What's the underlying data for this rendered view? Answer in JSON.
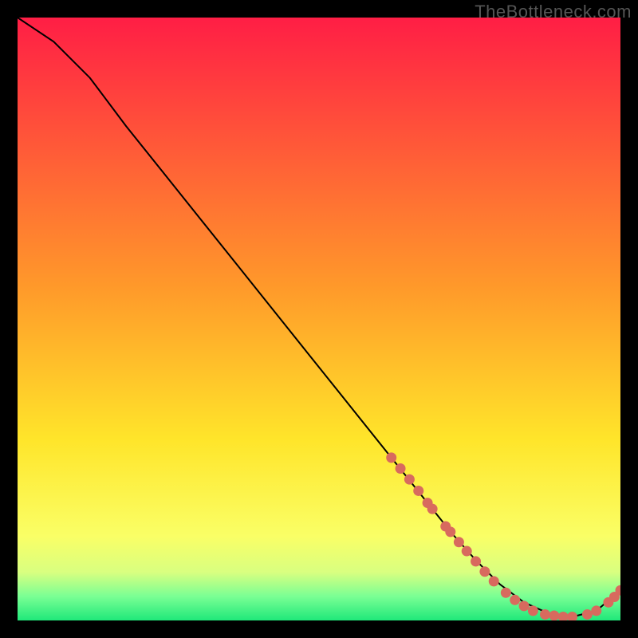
{
  "watermark": "TheBottleneck.com",
  "chart_data": {
    "type": "line",
    "title": "",
    "xlabel": "",
    "ylabel": "",
    "xlim": [
      0,
      100
    ],
    "ylim": [
      0,
      100
    ],
    "gradient_stops": [
      {
        "offset": 0,
        "color": "#ff1e45"
      },
      {
        "offset": 45,
        "color": "#ff9a2a"
      },
      {
        "offset": 70,
        "color": "#ffe52a"
      },
      {
        "offset": 86,
        "color": "#faff66"
      },
      {
        "offset": 92,
        "color": "#d9ff80"
      },
      {
        "offset": 96,
        "color": "#7aff94"
      },
      {
        "offset": 100,
        "color": "#1fe87a"
      }
    ],
    "series": [
      {
        "name": "bottleneck-curve",
        "x": [
          0,
          6,
          12,
          18,
          24,
          30,
          36,
          42,
          48,
          54,
          60,
          64,
          68,
          72,
          76,
          80,
          84,
          88,
          92,
          96,
          100
        ],
        "y": [
          100,
          96,
          90,
          82,
          74.5,
          67,
          59.5,
          52,
          44.5,
          37,
          29.5,
          24.5,
          19.5,
          14.5,
          10,
          6,
          3,
          1.2,
          0.6,
          1.6,
          5
        ]
      }
    ],
    "highlight_points": {
      "name": "marker-dots",
      "color": "#d86a5e",
      "points": [
        {
          "x": 62,
          "y": 27
        },
        {
          "x": 63.5,
          "y": 25.2
        },
        {
          "x": 65,
          "y": 23.4
        },
        {
          "x": 66.5,
          "y": 21.5
        },
        {
          "x": 68,
          "y": 19.5
        },
        {
          "x": 68.8,
          "y": 18.5
        },
        {
          "x": 71,
          "y": 15.6
        },
        {
          "x": 71.8,
          "y": 14.7
        },
        {
          "x": 73.2,
          "y": 13
        },
        {
          "x": 74.5,
          "y": 11.5
        },
        {
          "x": 76,
          "y": 9.8
        },
        {
          "x": 77.5,
          "y": 8.1
        },
        {
          "x": 79,
          "y": 6.5
        },
        {
          "x": 81,
          "y": 4.6
        },
        {
          "x": 82.5,
          "y": 3.4
        },
        {
          "x": 84,
          "y": 2.4
        },
        {
          "x": 85.5,
          "y": 1.6
        },
        {
          "x": 87.5,
          "y": 1.0
        },
        {
          "x": 89,
          "y": 0.8
        },
        {
          "x": 90.5,
          "y": 0.6
        },
        {
          "x": 92,
          "y": 0.6
        },
        {
          "x": 94.5,
          "y": 1.0
        },
        {
          "x": 96,
          "y": 1.6
        },
        {
          "x": 98,
          "y": 3.0
        },
        {
          "x": 99,
          "y": 3.9
        },
        {
          "x": 100,
          "y": 5.0
        }
      ]
    }
  }
}
